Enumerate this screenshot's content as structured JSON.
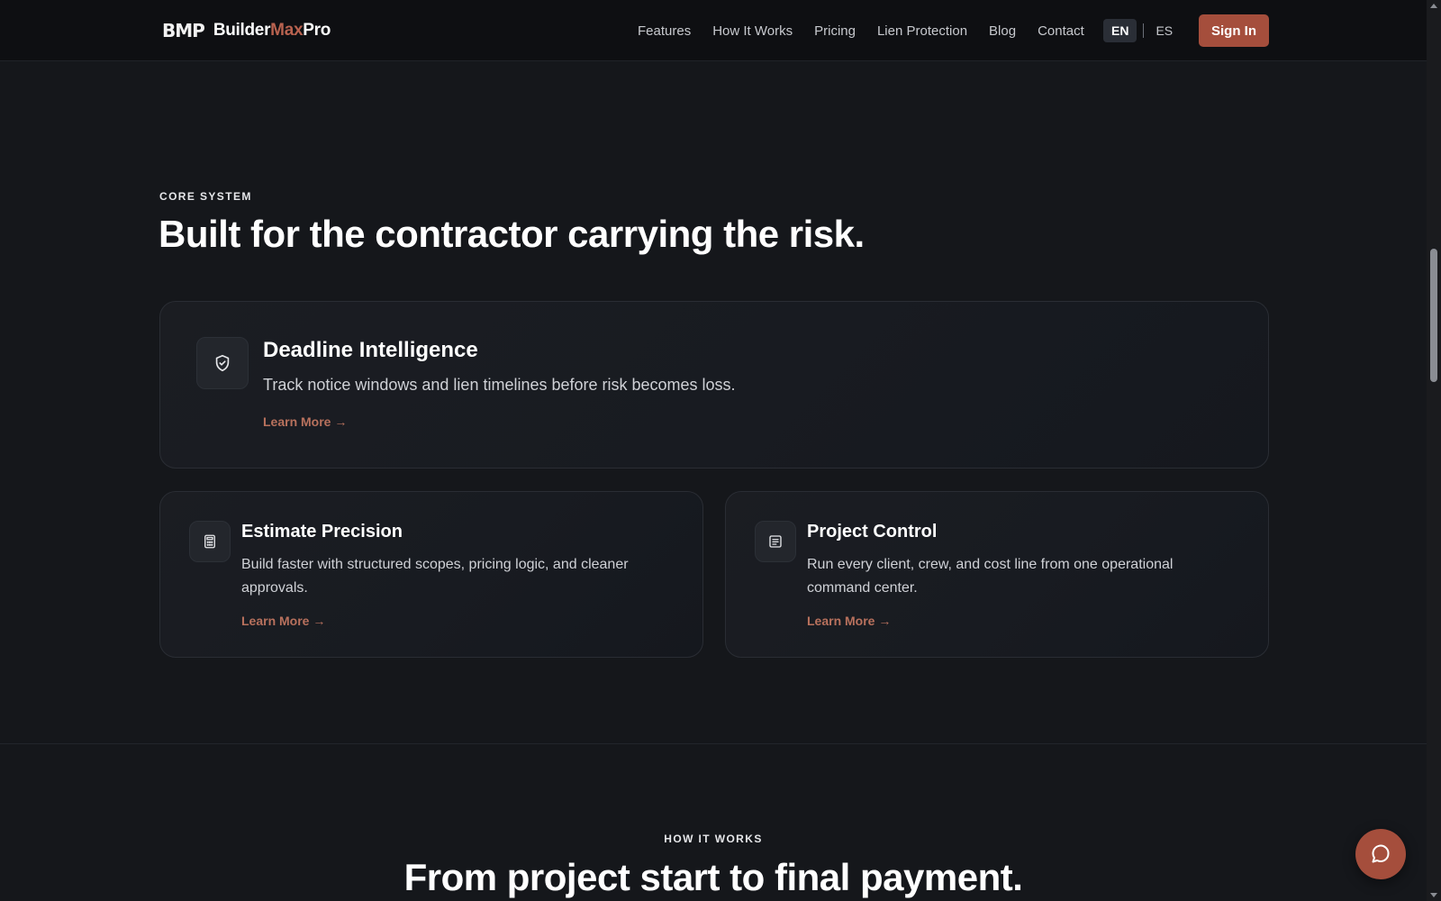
{
  "nav": {
    "logo_mark": "BMP",
    "logo_text_main": "Builder",
    "logo_text_accent": "Max",
    "logo_text_end": "Pro",
    "links": [
      "Features",
      "How It Works",
      "Pricing",
      "Lien Protection",
      "Blog",
      "Contact"
    ],
    "lang_active": "EN",
    "lang_other": "ES",
    "signin_label": "Sign In"
  },
  "core": {
    "eyebrow": "CORE SYSTEM",
    "heading": "Built for the contractor carrying the risk.",
    "cards": [
      {
        "icon": "shield-check-icon",
        "title": "Deadline Intelligence",
        "description": "Track notice windows and lien timelines before risk becomes loss.",
        "link": "Learn More →"
      },
      {
        "icon": "calculator-icon",
        "title": "Estimate Precision",
        "description": "Build faster with structured scopes, pricing logic, and cleaner approvals.",
        "link": "Learn More →"
      },
      {
        "icon": "document-list-icon",
        "title": "Project Control",
        "description": "Run every client, crew, and cost line from one operational command center.",
        "link": "Learn More →"
      }
    ]
  },
  "how": {
    "eyebrow": "HOW IT WORKS",
    "heading": "From project start to final payment."
  },
  "colors": {
    "accent": "#a54e3c",
    "link": "#b8715d",
    "background": "#15171b",
    "navbar": "#0e0f12"
  },
  "chat": {
    "icon": "chat-bubble-icon"
  }
}
